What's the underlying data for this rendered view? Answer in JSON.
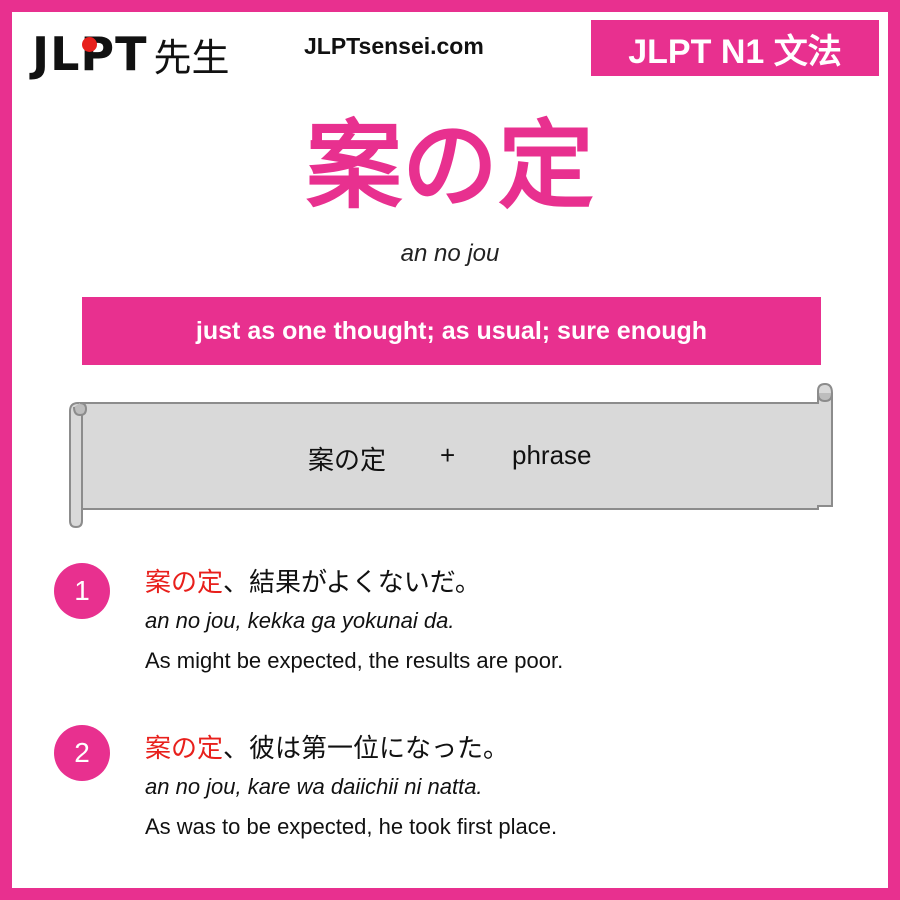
{
  "header": {
    "logo_latin": "JLPT",
    "logo_kanji": "先生",
    "site": "JLPTsensei.com",
    "badge": "JLPT N1 文法"
  },
  "grammar": {
    "title": "案の定",
    "romaji": "an no jou",
    "meaning": "just as one thought; as usual; sure enough"
  },
  "formula": {
    "part_a": "案の定",
    "plus": "+",
    "part_b": "phrase"
  },
  "examples": [
    {
      "number": "1",
      "jp_highlight": "案の定",
      "jp_rest": "、結果がよくないだ。",
      "romaji": "an no jou, kekka ga yokunai da.",
      "english": "As might be expected, the results are poor."
    },
    {
      "number": "2",
      "jp_highlight": "案の定",
      "jp_rest": "、彼は第一位になった。",
      "romaji": "an no jou, kare wa daiichii ni natta.",
      "english": "As was to be expected, he took first place."
    }
  ],
  "colors": {
    "brand_pink": "#e8308f",
    "highlight_red": "#e8201c",
    "scroll_fill": "#d9d9d9",
    "scroll_stroke": "#8c8c8c"
  }
}
